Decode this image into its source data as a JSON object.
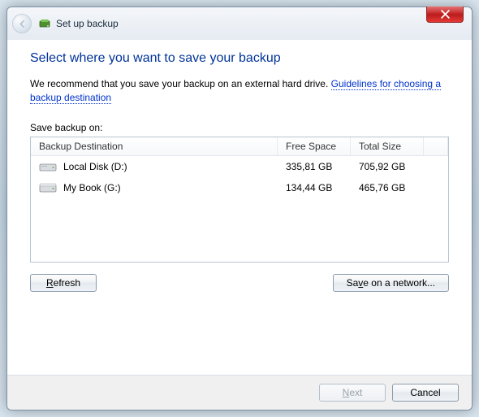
{
  "titlebar": {
    "title": "Set up backup"
  },
  "heading": "Select where you want to save your backup",
  "recommend": {
    "text": "We recommend that you save your backup on an external hard drive. ",
    "link": "Guidelines for choosing a backup destination"
  },
  "save_on_label": "Save backup on:",
  "columns": {
    "destination": "Backup Destination",
    "free": "Free Space",
    "total": "Total Size"
  },
  "drives": [
    {
      "name": "Local Disk (D:)",
      "free": "335,81 GB",
      "total": "705,92 GB"
    },
    {
      "name": "My Book (G:)",
      "free": "134,44 GB",
      "total": "465,76 GB"
    }
  ],
  "buttons": {
    "refresh": "Refresh",
    "save_network": "Save on a network...",
    "next": "Next",
    "cancel": "Cancel"
  }
}
